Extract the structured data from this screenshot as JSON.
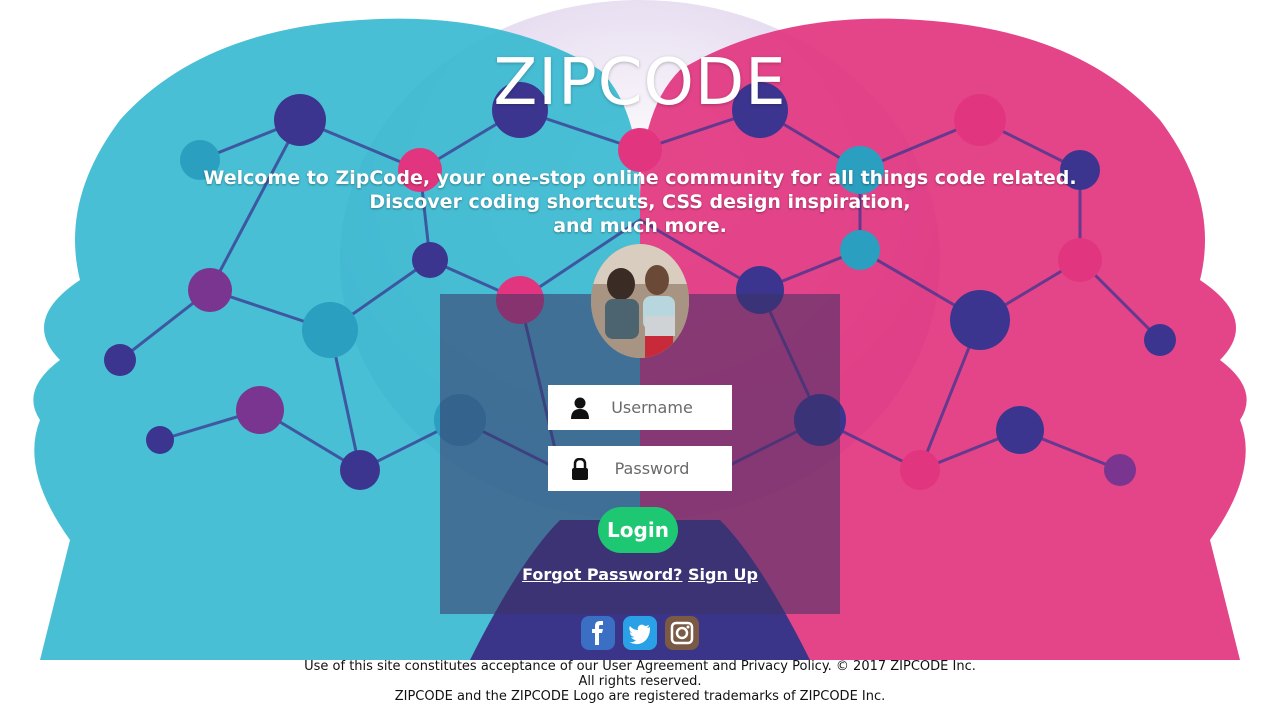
{
  "app": {
    "title": "ZIPCODE",
    "tagline_lines": [
      "Welcome to ZipCode, your one-stop online community for all things code related.",
      "Discover coding shortcuts, CSS design inspiration,",
      "and much more."
    ]
  },
  "login": {
    "username_placeholder": "Username",
    "password_placeholder": "Password",
    "login_label": "Login",
    "forgot_password": "Forgot Password?",
    "sign_up": "Sign Up"
  },
  "social": {
    "items": [
      {
        "name": "facebook",
        "icon": "facebook-icon",
        "color": "#3b6fc4"
      },
      {
        "name": "twitter",
        "icon": "twitter-icon",
        "color": "#2aa0e6"
      },
      {
        "name": "instagram",
        "icon": "instagram-icon",
        "color": "#7a5a45"
      }
    ]
  },
  "footer": {
    "line1": "Use of this site constitutes acceptance of our User Agreement and Privacy Policy. © 2017 ZIPCODE Inc.",
    "line2": "All rights reserved.",
    "line3": "ZIPCODE and the ZIPCODE Logo are registered trademarks of ZIPCODE Inc."
  },
  "colors": {
    "accent_green": "#1ec873",
    "teal": "#37b7cf",
    "magenta": "#e0357f",
    "navy": "#3a3588"
  }
}
